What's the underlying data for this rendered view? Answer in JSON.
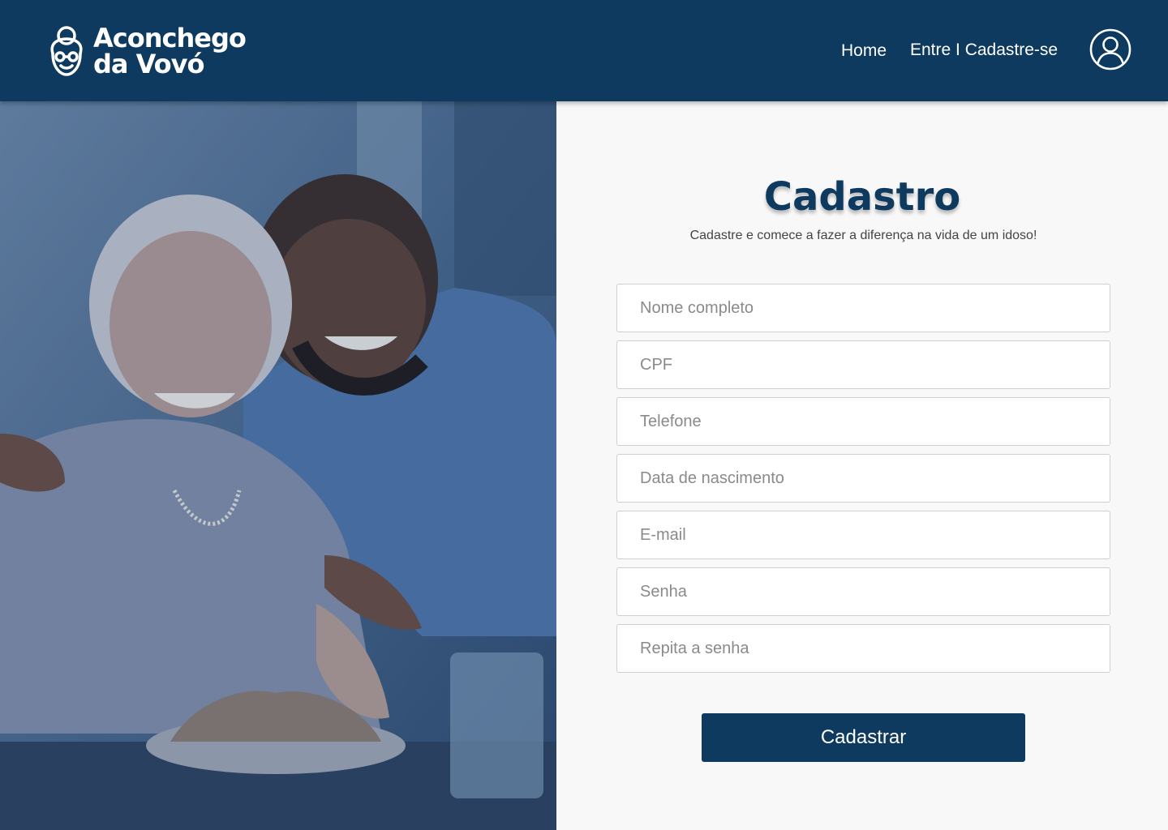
{
  "header": {
    "logo_line1": "Aconchego",
    "logo_line2": "da Vovó",
    "nav": {
      "home": "Home",
      "login": "Entre I Cadastre-se"
    },
    "user_icon": "user-circle-icon",
    "colors": {
      "bar": "#0d3a5e",
      "text": "#ffffff"
    }
  },
  "photo": {
    "icon": "caregiver-with-elderly-woman-photo"
  },
  "form": {
    "title": "Cadastro",
    "subtitle": "Cadastre e comece a fazer a diferença na vida de um idoso!",
    "fields": [
      {
        "placeholder": "Nome completo",
        "value": ""
      },
      {
        "placeholder": "CPF",
        "value": ""
      },
      {
        "placeholder": "Telefone",
        "value": ""
      },
      {
        "placeholder": "Data de nascimento",
        "value": ""
      },
      {
        "placeholder": "E-mail",
        "value": ""
      },
      {
        "placeholder": "Senha",
        "value": ""
      },
      {
        "placeholder": "Repita a senha",
        "value": ""
      }
    ],
    "submit_label": "Cadastrar",
    "accent": "#0d3a5e"
  }
}
